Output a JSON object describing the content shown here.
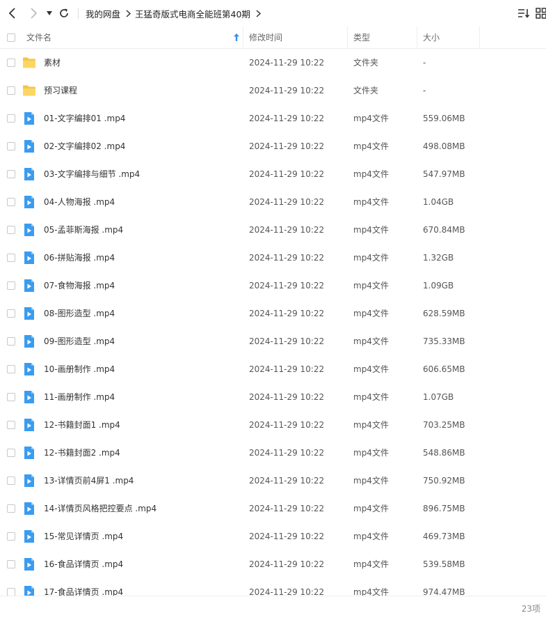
{
  "breadcrumb": [
    "我的网盘",
    "王猛奇版式电商全能班第40期"
  ],
  "columns": {
    "name": "文件名",
    "modified": "修改时间",
    "type": "类型",
    "size": "大小"
  },
  "colors": {
    "accent": "#3a8ee6",
    "folder": "#f7c543",
    "video": "#3a9cf0"
  },
  "files": [
    {
      "name": "素材",
      "modified": "2024-11-29 10:22",
      "type": "文件夹",
      "size": "-",
      "icon": "folder-icon"
    },
    {
      "name": "预习课程",
      "modified": "2024-11-29 10:22",
      "type": "文件夹",
      "size": "-",
      "icon": "folder-icon"
    },
    {
      "name": "01-文字编排01 .mp4",
      "modified": "2024-11-29 10:22",
      "type": "mp4文件",
      "size": "559.06MB",
      "icon": "video-file-icon"
    },
    {
      "name": "02-文字编排02 .mp4",
      "modified": "2024-11-29 10:22",
      "type": "mp4文件",
      "size": "498.08MB",
      "icon": "video-file-icon"
    },
    {
      "name": "03-文字编排与细节 .mp4",
      "modified": "2024-11-29 10:22",
      "type": "mp4文件",
      "size": "547.97MB",
      "icon": "video-file-icon"
    },
    {
      "name": "04-人物海报 .mp4",
      "modified": "2024-11-29 10:22",
      "type": "mp4文件",
      "size": "1.04GB",
      "icon": "video-file-icon"
    },
    {
      "name": "05-孟菲斯海报 .mp4",
      "modified": "2024-11-29 10:22",
      "type": "mp4文件",
      "size": "670.84MB",
      "icon": "video-file-icon"
    },
    {
      "name": "06-拼贴海报 .mp4",
      "modified": "2024-11-29 10:22",
      "type": "mp4文件",
      "size": "1.32GB",
      "icon": "video-file-icon"
    },
    {
      "name": "07-食物海报 .mp4",
      "modified": "2024-11-29 10:22",
      "type": "mp4文件",
      "size": "1.09GB",
      "icon": "video-file-icon"
    },
    {
      "name": "08-图形造型 .mp4",
      "modified": "2024-11-29 10:22",
      "type": "mp4文件",
      "size": "628.59MB",
      "icon": "video-file-icon"
    },
    {
      "name": "09-图形造型 .mp4",
      "modified": "2024-11-29 10:22",
      "type": "mp4文件",
      "size": "735.33MB",
      "icon": "video-file-icon"
    },
    {
      "name": "10-画册制作 .mp4",
      "modified": "2024-11-29 10:22",
      "type": "mp4文件",
      "size": "606.65MB",
      "icon": "video-file-icon"
    },
    {
      "name": "11-画册制作 .mp4",
      "modified": "2024-11-29 10:22",
      "type": "mp4文件",
      "size": "1.07GB",
      "icon": "video-file-icon"
    },
    {
      "name": "12-书籍封面1 .mp4",
      "modified": "2024-11-29 10:22",
      "type": "mp4文件",
      "size": "703.25MB",
      "icon": "video-file-icon"
    },
    {
      "name": "12-书籍封面2 .mp4",
      "modified": "2024-11-29 10:22",
      "type": "mp4文件",
      "size": "548.86MB",
      "icon": "video-file-icon"
    },
    {
      "name": "13-详情页前4屏1 .mp4",
      "modified": "2024-11-29 10:22",
      "type": "mp4文件",
      "size": "750.92MB",
      "icon": "video-file-icon"
    },
    {
      "name": "14-详情页风格把控要点 .mp4",
      "modified": "2024-11-29 10:22",
      "type": "mp4文件",
      "size": "896.75MB",
      "icon": "video-file-icon"
    },
    {
      "name": "15-常见详情页 .mp4",
      "modified": "2024-11-29 10:22",
      "type": "mp4文件",
      "size": "469.73MB",
      "icon": "video-file-icon"
    },
    {
      "name": "16-食品详情页 .mp4",
      "modified": "2024-11-29 10:22",
      "type": "mp4文件",
      "size": "539.58MB",
      "icon": "video-file-icon"
    },
    {
      "name": "17-食品详情页 .mp4",
      "modified": "2024-11-29 10:22",
      "type": "mp4文件",
      "size": "974.47MB",
      "icon": "video-file-icon"
    }
  ],
  "footer": {
    "count": "23项"
  }
}
